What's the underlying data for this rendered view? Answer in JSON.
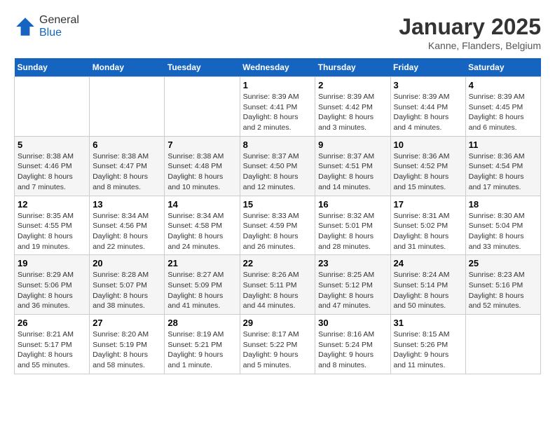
{
  "header": {
    "logo_general": "General",
    "logo_blue": "Blue",
    "month_title": "January 2025",
    "location": "Kanne, Flanders, Belgium"
  },
  "weekdays": [
    "Sunday",
    "Monday",
    "Tuesday",
    "Wednesday",
    "Thursday",
    "Friday",
    "Saturday"
  ],
  "weeks": [
    [
      {
        "day": "",
        "info": ""
      },
      {
        "day": "",
        "info": ""
      },
      {
        "day": "",
        "info": ""
      },
      {
        "day": "1",
        "info": "Sunrise: 8:39 AM\nSunset: 4:41 PM\nDaylight: 8 hours\nand 2 minutes."
      },
      {
        "day": "2",
        "info": "Sunrise: 8:39 AM\nSunset: 4:42 PM\nDaylight: 8 hours\nand 3 minutes."
      },
      {
        "day": "3",
        "info": "Sunrise: 8:39 AM\nSunset: 4:44 PM\nDaylight: 8 hours\nand 4 minutes."
      },
      {
        "day": "4",
        "info": "Sunrise: 8:39 AM\nSunset: 4:45 PM\nDaylight: 8 hours\nand 6 minutes."
      }
    ],
    [
      {
        "day": "5",
        "info": "Sunrise: 8:38 AM\nSunset: 4:46 PM\nDaylight: 8 hours\nand 7 minutes."
      },
      {
        "day": "6",
        "info": "Sunrise: 8:38 AM\nSunset: 4:47 PM\nDaylight: 8 hours\nand 8 minutes."
      },
      {
        "day": "7",
        "info": "Sunrise: 8:38 AM\nSunset: 4:48 PM\nDaylight: 8 hours\nand 10 minutes."
      },
      {
        "day": "8",
        "info": "Sunrise: 8:37 AM\nSunset: 4:50 PM\nDaylight: 8 hours\nand 12 minutes."
      },
      {
        "day": "9",
        "info": "Sunrise: 8:37 AM\nSunset: 4:51 PM\nDaylight: 8 hours\nand 14 minutes."
      },
      {
        "day": "10",
        "info": "Sunrise: 8:36 AM\nSunset: 4:52 PM\nDaylight: 8 hours\nand 15 minutes."
      },
      {
        "day": "11",
        "info": "Sunrise: 8:36 AM\nSunset: 4:54 PM\nDaylight: 8 hours\nand 17 minutes."
      }
    ],
    [
      {
        "day": "12",
        "info": "Sunrise: 8:35 AM\nSunset: 4:55 PM\nDaylight: 8 hours\nand 19 minutes."
      },
      {
        "day": "13",
        "info": "Sunrise: 8:34 AM\nSunset: 4:56 PM\nDaylight: 8 hours\nand 22 minutes."
      },
      {
        "day": "14",
        "info": "Sunrise: 8:34 AM\nSunset: 4:58 PM\nDaylight: 8 hours\nand 24 minutes."
      },
      {
        "day": "15",
        "info": "Sunrise: 8:33 AM\nSunset: 4:59 PM\nDaylight: 8 hours\nand 26 minutes."
      },
      {
        "day": "16",
        "info": "Sunrise: 8:32 AM\nSunset: 5:01 PM\nDaylight: 8 hours\nand 28 minutes."
      },
      {
        "day": "17",
        "info": "Sunrise: 8:31 AM\nSunset: 5:02 PM\nDaylight: 8 hours\nand 31 minutes."
      },
      {
        "day": "18",
        "info": "Sunrise: 8:30 AM\nSunset: 5:04 PM\nDaylight: 8 hours\nand 33 minutes."
      }
    ],
    [
      {
        "day": "19",
        "info": "Sunrise: 8:29 AM\nSunset: 5:06 PM\nDaylight: 8 hours\nand 36 minutes."
      },
      {
        "day": "20",
        "info": "Sunrise: 8:28 AM\nSunset: 5:07 PM\nDaylight: 8 hours\nand 38 minutes."
      },
      {
        "day": "21",
        "info": "Sunrise: 8:27 AM\nSunset: 5:09 PM\nDaylight: 8 hours\nand 41 minutes."
      },
      {
        "day": "22",
        "info": "Sunrise: 8:26 AM\nSunset: 5:11 PM\nDaylight: 8 hours\nand 44 minutes."
      },
      {
        "day": "23",
        "info": "Sunrise: 8:25 AM\nSunset: 5:12 PM\nDaylight: 8 hours\nand 47 minutes."
      },
      {
        "day": "24",
        "info": "Sunrise: 8:24 AM\nSunset: 5:14 PM\nDaylight: 8 hours\nand 50 minutes."
      },
      {
        "day": "25",
        "info": "Sunrise: 8:23 AM\nSunset: 5:16 PM\nDaylight: 8 hours\nand 52 minutes."
      }
    ],
    [
      {
        "day": "26",
        "info": "Sunrise: 8:21 AM\nSunset: 5:17 PM\nDaylight: 8 hours\nand 55 minutes."
      },
      {
        "day": "27",
        "info": "Sunrise: 8:20 AM\nSunset: 5:19 PM\nDaylight: 8 hours\nand 58 minutes."
      },
      {
        "day": "28",
        "info": "Sunrise: 8:19 AM\nSunset: 5:21 PM\nDaylight: 9 hours\nand 1 minute."
      },
      {
        "day": "29",
        "info": "Sunrise: 8:17 AM\nSunset: 5:22 PM\nDaylight: 9 hours\nand 5 minutes."
      },
      {
        "day": "30",
        "info": "Sunrise: 8:16 AM\nSunset: 5:24 PM\nDaylight: 9 hours\nand 8 minutes."
      },
      {
        "day": "31",
        "info": "Sunrise: 8:15 AM\nSunset: 5:26 PM\nDaylight: 9 hours\nand 11 minutes."
      },
      {
        "day": "",
        "info": ""
      }
    ]
  ]
}
